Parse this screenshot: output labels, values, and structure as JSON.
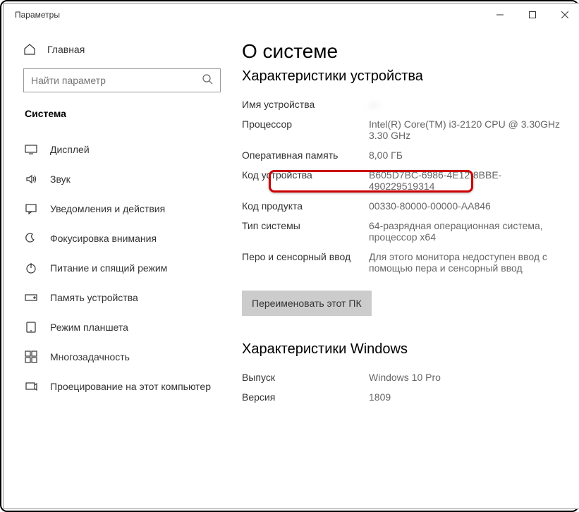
{
  "window": {
    "title": "Параметры"
  },
  "sidebar": {
    "home": "Главная",
    "search_placeholder": "Найти параметр",
    "category": "Система",
    "items": [
      {
        "label": "Дисплей",
        "icon": "display"
      },
      {
        "label": "Звук",
        "icon": "sound"
      },
      {
        "label": "Уведомления и действия",
        "icon": "notifications"
      },
      {
        "label": "Фокусировка внимания",
        "icon": "focus"
      },
      {
        "label": "Питание и спящий режим",
        "icon": "power"
      },
      {
        "label": "Память устройства",
        "icon": "storage"
      },
      {
        "label": "Режим планшета",
        "icon": "tablet"
      },
      {
        "label": "Многозадачность",
        "icon": "multitask"
      },
      {
        "label": "Проецирование на этот компьютер",
        "icon": "project"
      }
    ]
  },
  "main": {
    "title": "О системе",
    "device_heading": "Характеристики устройства",
    "rename_button": "Переименовать этот ПК",
    "windows_heading": "Характеристики Windows",
    "specs": {
      "device_name_label": "Имя устройства",
      "device_name_value": "—",
      "cpu_label": "Процессор",
      "cpu_value": "Intel(R) Core(TM) i3-2120 CPU @ 3.30GHz   3.30 GHz",
      "ram_label": "Оперативная память",
      "ram_value": "8,00 ГБ",
      "device_id_label": "Код устройства",
      "device_id_value": "B605D7BC-6986-4E12-8BBE-490229519314",
      "product_id_label": "Код продукта",
      "product_id_value": "00330-80000-00000-AA846",
      "system_type_label": "Тип системы",
      "system_type_value": "64-разрядная операционная система, процессор x64",
      "pen_label": "Перо и сенсорный ввод",
      "pen_value": "Для этого монитора недоступен ввод с помощью пера и сенсорный ввод"
    },
    "windows_specs": {
      "edition_label": "Выпуск",
      "edition_value": "Windows 10 Pro",
      "version_label": "Версия",
      "version_value": "1809"
    }
  }
}
